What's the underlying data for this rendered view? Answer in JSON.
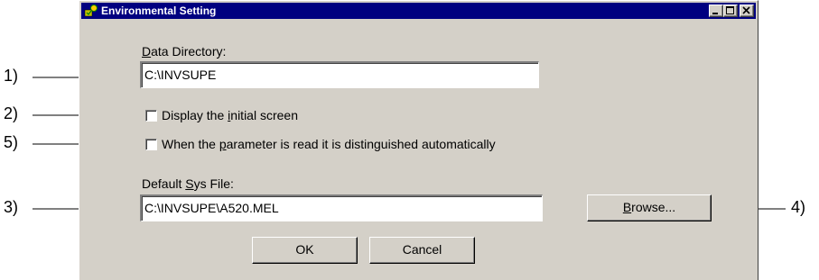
{
  "window": {
    "title": "Environmental Setting"
  },
  "data_directory": {
    "label_prefix": "",
    "label_access": "D",
    "label_rest": "ata Directory:",
    "value": "C:\\INVSUPE"
  },
  "options": {
    "initial_screen": {
      "label_before": "Display the ",
      "label_access": "i",
      "label_after": "nitial screen",
      "checked": false
    },
    "auto_distinguish": {
      "label_before": "When the ",
      "label_access": "p",
      "label_after": "arameter is read it is distinguished automatically",
      "checked": false
    }
  },
  "sys_file": {
    "label_before": "Default ",
    "label_access": "S",
    "label_after": "ys File:",
    "value": "C:\\INVSUPE\\A520.MEL"
  },
  "buttons": {
    "browse_access": "B",
    "browse_rest": "rowse...",
    "ok": "OK",
    "cancel": "Cancel"
  },
  "callouts": {
    "c1": "1)",
    "c2": "2)",
    "c3": "3)",
    "c4": "4)",
    "c5": "5)"
  }
}
